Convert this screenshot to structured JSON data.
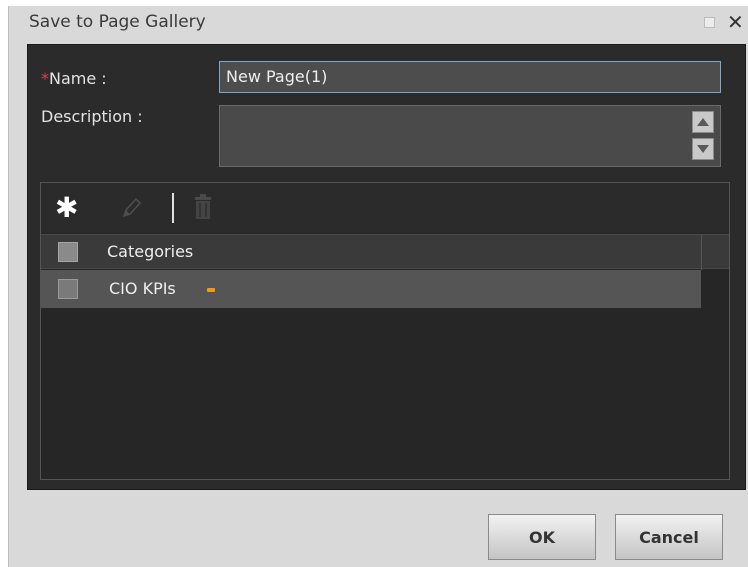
{
  "dialog": {
    "title": "Save to Page Gallery"
  },
  "form": {
    "name_label": "Name :",
    "name_required_marker": "*",
    "name_value": "New Page(1)",
    "description_label": "Description :",
    "description_value": ""
  },
  "categories": {
    "toolbar": {
      "add_icon": "asterisk-icon",
      "edit_icon": "pencil-icon",
      "delete_icon": "trash-icon"
    },
    "header_label": "Categories",
    "rows": [
      {
        "label": "CIO KPIs",
        "checked": false
      }
    ]
  },
  "buttons": {
    "ok": "OK",
    "cancel": "Cancel"
  },
  "colors": {
    "required": "#d94040",
    "indicator": "#f09a1a",
    "input_focus_border": "#7aa9cf"
  }
}
